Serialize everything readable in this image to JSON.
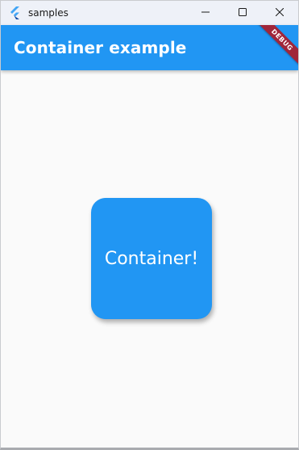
{
  "window": {
    "title": "samples",
    "app_icon": "flutter-logo-icon",
    "controls": {
      "minimize_icon": "minimize-icon",
      "maximize_icon": "maximize-icon",
      "close_icon": "close-icon"
    }
  },
  "appbar": {
    "title": "Container example",
    "color": "#2196f3"
  },
  "debug_banner": {
    "label": "DEBUG",
    "color": "#a0263a"
  },
  "container": {
    "label": "Container!",
    "color": "#2196f3"
  }
}
